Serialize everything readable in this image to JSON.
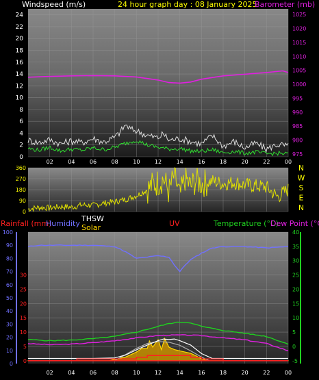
{
  "chart_data": [
    {
      "type": "line",
      "title": "24 hour graph day : 08 January 2025",
      "left_label": "Windspeed (m/s)",
      "right_label": "Barometer (mb)",
      "x_ticks": [
        "02",
        "04",
        "06",
        "08",
        "10",
        "12",
        "14",
        "16",
        "18",
        "20",
        "22",
        "00"
      ],
      "y_left_ticks": [
        "0",
        "2",
        "4",
        "6",
        "8",
        "10",
        "12",
        "14",
        "16",
        "18",
        "20",
        "22",
        "24"
      ],
      "y_left_range": [
        0,
        25
      ],
      "y_right_ticks": [
        "975",
        "980",
        "985",
        "990",
        "995",
        "1000",
        "1005",
        "1010",
        "1015",
        "1020",
        "1025"
      ],
      "y_right_range": [
        974,
        1027
      ],
      "series": [
        {
          "key": "barometer",
          "axis": "right",
          "color": "#e020e0",
          "x": [
            0,
            2,
            4,
            6,
            8,
            10,
            12,
            13,
            14,
            15,
            16,
            18,
            20,
            22,
            23.5,
            24
          ],
          "values": [
            1002.5,
            1002.8,
            1003,
            1003.1,
            1003,
            1002.6,
            1001.5,
            1000.6,
            1000.4,
            1000.8,
            1001.8,
            1003,
            1003.6,
            1004.2,
            1004.8,
            1004.2
          ]
        },
        {
          "key": "gust",
          "axis": "left",
          "color": "#dddddd",
          "x": [
            0,
            1,
            2,
            3,
            4,
            5,
            6,
            7,
            8,
            8.5,
            9,
            9.5,
            10,
            11,
            12,
            12.5,
            13,
            14,
            15,
            16,
            17,
            18,
            19,
            20,
            21,
            22,
            23,
            24
          ],
          "values": [
            2.8,
            2.4,
            2.9,
            2.2,
            2.7,
            2.4,
            3.1,
            2.5,
            3.3,
            4.2,
            5.4,
            4.6,
            4.4,
            3.6,
            3.2,
            3.9,
            2.8,
            3.1,
            2.6,
            2.2,
            3.6,
            1.8,
            2.6,
            1.5,
            2.3,
            1.3,
            2.1,
            1.8
          ]
        },
        {
          "key": "wind",
          "axis": "left",
          "color": "#30e030",
          "x": [
            0,
            1,
            2,
            3,
            4,
            5,
            6,
            7,
            8,
            9,
            10,
            11,
            12,
            13,
            14,
            15,
            16,
            17,
            18,
            19,
            20,
            21,
            22,
            23,
            24
          ],
          "values": [
            1.4,
            1.1,
            1.6,
            1.0,
            1.3,
            1.1,
            1.5,
            1.2,
            1.6,
            2.3,
            2.8,
            2.0,
            1.6,
            1.3,
            1.4,
            1.0,
            0.9,
            1.2,
            0.7,
            0.9,
            0.6,
            0.8,
            0.5,
            0.6,
            0.5
          ]
        }
      ],
      "grid": true
    },
    {
      "type": "line",
      "title": "",
      "y_left_ticks": [
        "0",
        "90",
        "180",
        "270",
        "360"
      ],
      "y_left_range": [
        0,
        360
      ],
      "y_right_ticks": [
        "N",
        "W",
        "S",
        "E",
        "N"
      ],
      "series": [
        {
          "key": "direction",
          "color": "#e0e000",
          "x": [
            0,
            1,
            2,
            3,
            4,
            5,
            6,
            7,
            8,
            9,
            10,
            11,
            11.5,
            12,
            12.5,
            13,
            13.5,
            14,
            14.5,
            15,
            15.5,
            16,
            17,
            18,
            19,
            20,
            21,
            22,
            23,
            24
          ],
          "values": [
            20,
            35,
            30,
            40,
            35,
            55,
            50,
            70,
            80,
            100,
            130,
            180,
            220,
            240,
            270,
            160,
            300,
            120,
            280,
            200,
            260,
            230,
            250,
            230,
            240,
            220,
            210,
            200,
            120,
            180
          ]
        }
      ],
      "grid": true
    },
    {
      "type": "line",
      "title": "",
      "legend": {
        "rain": "Rainfall (mm)",
        "humidity": "Humidity",
        "thsw": "THSW",
        "solar": "Solar",
        "uv": "UV",
        "temperature": "Temperature (°C)",
        "dewpoint": "Dew Point (°C)"
      },
      "x_ticks": [
        "02",
        "04",
        "06",
        "08",
        "10",
        "12",
        "14",
        "16",
        "18",
        "20",
        "22",
        "00"
      ],
      "humidity_ticks": [
        "0",
        "10",
        "20",
        "30",
        "40",
        "50",
        "60",
        "70",
        "80",
        "90",
        "100"
      ],
      "rain_ticks": [
        "0",
        "5",
        "10",
        "15",
        "20",
        "25",
        "30"
      ],
      "temp_ticks": [
        "-5",
        "0",
        "5",
        "10",
        "15",
        "20",
        "25",
        "30",
        "35",
        "40"
      ],
      "temp_range": [
        -6,
        40
      ],
      "humidity_range": [
        0,
        100
      ],
      "series": [
        {
          "key": "humidity",
          "color": "#7070ff",
          "values_x": [
            0,
            1,
            2,
            4,
            6,
            8,
            9,
            10,
            11,
            12,
            13,
            13.5,
            14,
            14.5,
            15,
            16,
            17,
            18,
            20,
            22,
            24
          ],
          "values": [
            89,
            90,
            90,
            90,
            90,
            89,
            85,
            80,
            81,
            82,
            81,
            75,
            70,
            75,
            79,
            84,
            88,
            89,
            89,
            88,
            89
          ]
        },
        {
          "key": "temperature",
          "color": "#20d020",
          "values_x": [
            0,
            2,
            4,
            6,
            8,
            10,
            12,
            13,
            14,
            15,
            16,
            18,
            20,
            22,
            24
          ],
          "values": [
            2.4,
            2.0,
            2.2,
            2.7,
            3.5,
            5.0,
            7.0,
            8.0,
            8.5,
            8.3,
            7.0,
            5.6,
            4.6,
            3.5,
            0.8
          ]
        },
        {
          "key": "dewpoint",
          "color": "#e020e0",
          "values_x": [
            0,
            2,
            4,
            6,
            8,
            10,
            12,
            14,
            16,
            18,
            20,
            22,
            24
          ],
          "values": [
            1.0,
            0.6,
            0.8,
            1.3,
            2.0,
            3.0,
            3.8,
            4.0,
            3.8,
            3.0,
            2.3,
            1.0,
            -1.5
          ]
        },
        {
          "key": "thsw",
          "color": "#ffffff",
          "values_x": [
            0,
            2,
            4,
            6,
            8,
            9,
            10,
            11,
            12,
            12.5,
            13,
            13.5,
            14,
            15,
            16,
            17,
            18,
            20,
            22,
            24
          ],
          "values": [
            -4.2,
            -4.2,
            -4.2,
            -4.2,
            -4.0,
            -3.0,
            -1.2,
            0.5,
            2.0,
            2.6,
            2.4,
            2.6,
            2.0,
            0.5,
            -2.5,
            -4.2,
            -4.2,
            -4.2,
            -4.2,
            -4.2
          ]
        },
        {
          "key": "solar",
          "color": "#ffd700",
          "values_x": [
            0,
            7.5,
            8,
            9,
            10,
            10.5,
            11,
            11.2,
            11.5,
            12,
            12.3,
            12.6,
            13,
            13.5,
            14,
            14.5,
            15,
            15.5,
            16,
            16.5,
            24
          ],
          "values": [
            0,
            0,
            2,
            6,
            14,
            20,
            20,
            32,
            22,
            34,
            18,
            36,
            22,
            18,
            16,
            14,
            12,
            8,
            3,
            0,
            0
          ]
        },
        {
          "key": "uv",
          "color": "#ff2020",
          "values_x": [
            0,
            4,
            4.5,
            5,
            6,
            7,
            8,
            9,
            10,
            10.5,
            11,
            11.5,
            12,
            13,
            14,
            15,
            16,
            17,
            18,
            24
          ],
          "values": [
            0,
            0,
            1,
            1,
            1,
            1,
            1,
            1,
            2,
            2,
            3,
            3,
            3,
            3,
            3,
            2,
            1,
            1,
            0,
            0
          ]
        },
        {
          "key": "solar_max",
          "color": "#aaaaaa",
          "values_x": [
            8,
            9,
            10,
            11,
            12,
            13,
            14,
            15,
            16,
            16.7
          ],
          "values": [
            0,
            10,
            20,
            28,
            31,
            30,
            25,
            16,
            6,
            0
          ]
        }
      ],
      "grid": true
    }
  ]
}
